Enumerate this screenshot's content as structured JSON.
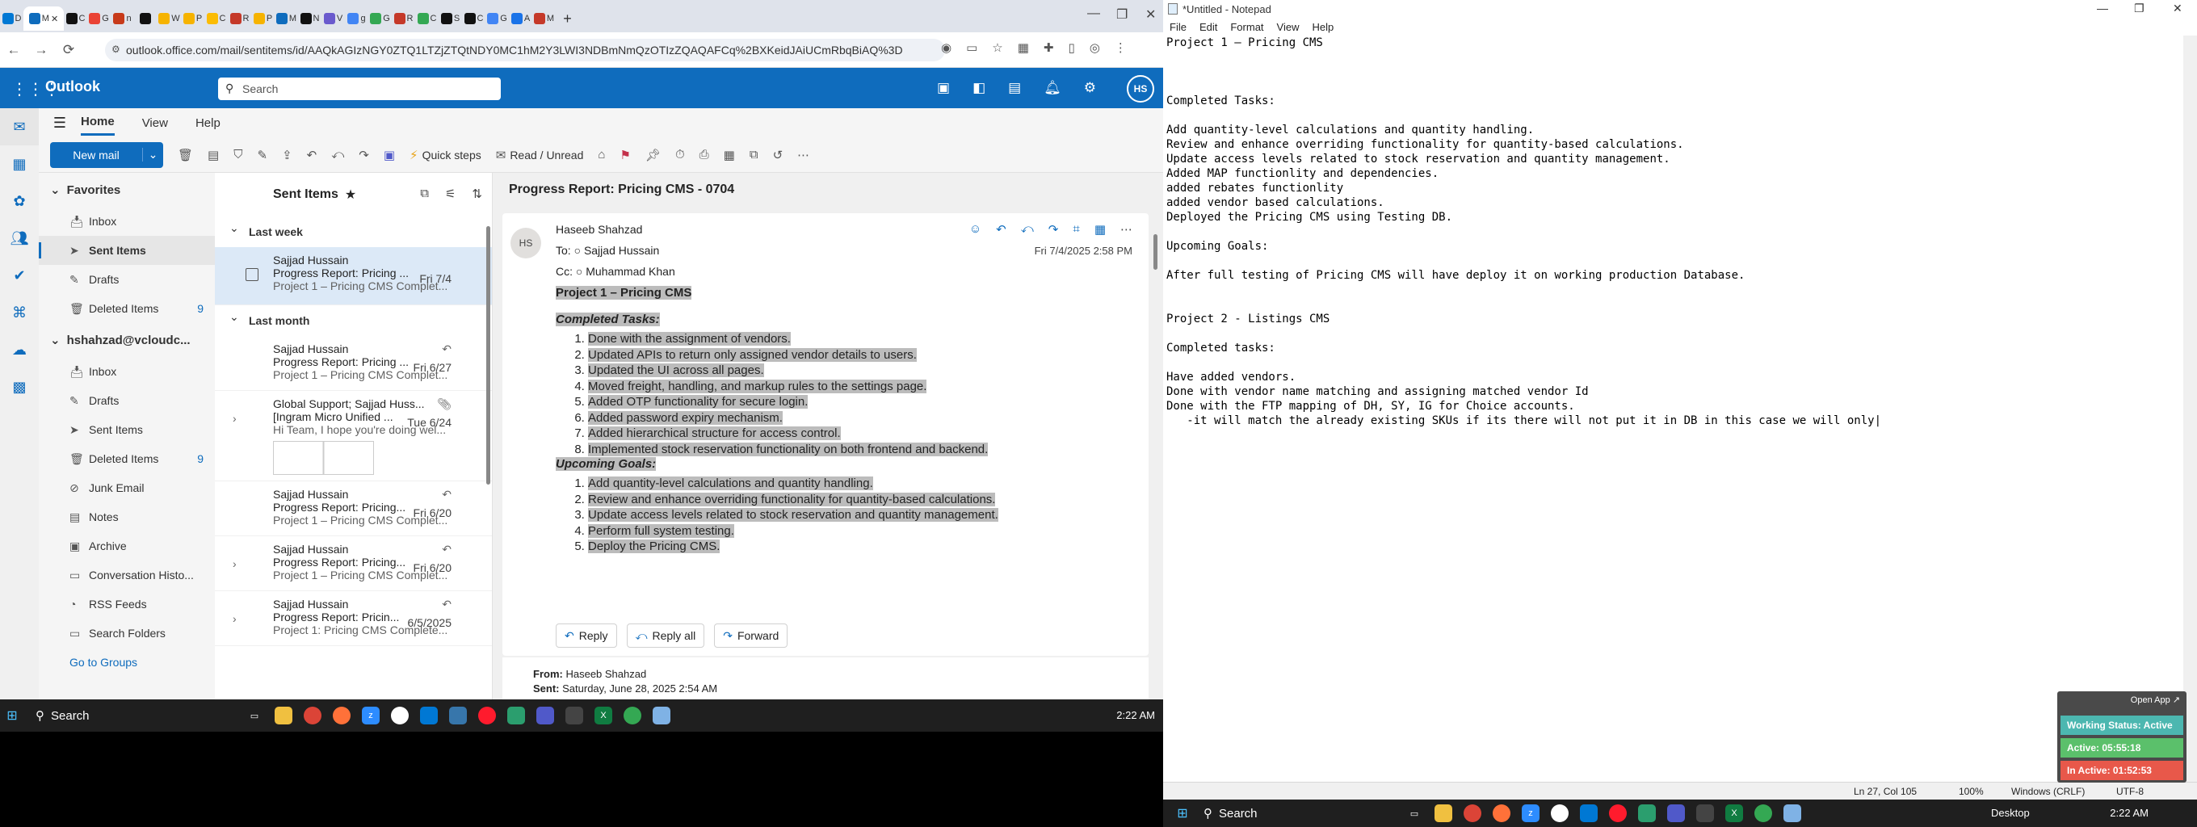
{
  "browser": {
    "tabs": [
      "D",
      "",
      "C",
      "G",
      "n",
      "",
      "W",
      "P",
      "C",
      "R",
      "P",
      "M",
      "N",
      "V",
      "g",
      "G",
      "R",
      "C",
      "S",
      "C",
      "G",
      "A",
      "M"
    ],
    "tab_colors": [
      "#0078d4",
      "#0f6cbd",
      "#111111",
      "#ea4335",
      "#c73a1a",
      "#111111",
      "#f6b300",
      "#f6b300",
      "#fbbc04",
      "#c53929",
      "#f6b300",
      "#0f6cbd",
      "#111111",
      "#6a5acd",
      "#4285f4",
      "#34a853",
      "#c53929",
      "#34a853",
      "#111111",
      "#111111",
      "#4285f4",
      "#1a73e8",
      "#c53929"
    ],
    "active_tab_label": "M",
    "url": "outlook.office.com/mail/sentitems/id/AAQkAGIzNGY0ZTQ1LTZjZTQtNDY0MC1hM2Y3LWI3NDBmNmQzOTIzZQAQAFCq%2BXKeidJAiUCmRbqBiAQ%3D"
  },
  "outlook": {
    "brand": "Outlook",
    "search_placeholder": "Search",
    "user_initials": "HS",
    "ribbon_tabs": [
      "Home",
      "View",
      "Help"
    ],
    "new_mail": "New mail",
    "quick_steps": "Quick steps",
    "read_unread": "Read / Unread"
  },
  "folders": {
    "favorites_header": "Favorites",
    "favorites": [
      {
        "label": "Inbox",
        "count": ""
      },
      {
        "label": "Sent Items",
        "count": ""
      },
      {
        "label": "Drafts",
        "count": ""
      },
      {
        "label": "Deleted Items",
        "count": "9"
      }
    ],
    "account_header": "hshahzad@vcloudc...",
    "account": [
      {
        "label": "Inbox",
        "count": ""
      },
      {
        "label": "Drafts",
        "count": ""
      },
      {
        "label": "Sent Items",
        "count": ""
      },
      {
        "label": "Deleted Items",
        "count": "9"
      },
      {
        "label": "Junk Email",
        "count": ""
      },
      {
        "label": "Notes",
        "count": ""
      },
      {
        "label": "Archive",
        "count": ""
      },
      {
        "label": "Conversation Histo...",
        "count": ""
      },
      {
        "label": "RSS Feeds",
        "count": ""
      },
      {
        "label": "Search Folders",
        "count": ""
      }
    ],
    "go_to_groups": "Go to Groups"
  },
  "message_list": {
    "title": "Sent Items",
    "groups": [
      "Last week",
      "Last month"
    ],
    "messages": [
      {
        "from": "Sajjad Hussain",
        "subject": "Progress Report: Pricing ...",
        "date": "Fri 7/4",
        "preview": "Project 1 – Pricing CMS Complet..."
      },
      {
        "from": "Sajjad Hussain",
        "subject": "Progress Report: Pricing ...",
        "date": "Fri 6/27",
        "preview": "Project 1 – Pricing CMS Complet..."
      },
      {
        "from": "Global Support; Sajjad Huss...",
        "subject": "[Ingram Micro Unified ...",
        "date": "Tue 6/24",
        "preview": "Hi Team, I hope you're doing wel..."
      },
      {
        "from": "Sajjad Hussain",
        "subject": "Progress Report: Pricing...",
        "date": "Fri 6/20",
        "preview": "Project 1 – Pricing CMS Complet..."
      },
      {
        "from": "Sajjad Hussain",
        "subject": "Progress Report: Pricing...",
        "date": "Fri 6/20",
        "preview": "Project 1 – Pricing CMS Complet..."
      },
      {
        "from": "Sajjad Hussain",
        "subject": "Progress Report: Pricin...",
        "date": "6/5/2025",
        "preview": "Project 1: Pricing CMS Complete..."
      }
    ]
  },
  "reading": {
    "subject": "Progress Report: Pricing CMS - 0704",
    "avatar": "HS",
    "sender": "Haseeb Shahzad",
    "to_label": "To:",
    "to": "Sajjad Hussain",
    "cc_label": "Cc:",
    "cc": "Muhammad Khan",
    "date": "Fri 7/4/2025 2:58 PM",
    "heading": "Project 1 – Pricing CMS",
    "completed_heading": "Completed Tasks:",
    "completed": [
      "Done with the assignment of vendors.",
      "Updated APIs to return only assigned vendor details to users.",
      "Updated the UI across all pages.",
      "Moved freight, handling, and markup rules to the settings page.",
      "Added OTP functionality for secure login.",
      "Added password expiry mechanism.",
      "Added hierarchical structure for access control.",
      "Implemented stock reservation functionality on both frontend and backend."
    ],
    "upcoming_heading": "Upcoming Goals:",
    "upcoming": [
      "Add quantity-level calculations and quantity handling.",
      "Review and enhance overriding functionality for quantity-based calculations.",
      "Update access levels related to stock reservation and quantity management.",
      "Perform full system testing.",
      "Deploy the Pricing CMS."
    ],
    "reply": "Reply",
    "reply_all": "Reply all",
    "forward": "Forward",
    "from_label": "From:",
    "from_value": "Haseeb Shahzad",
    "sent_label": "Sent:",
    "sent_value": "Saturday, June 28, 2025 2:54 AM"
  },
  "taskbar_left": {
    "search": "Search",
    "time": "2:22 AM"
  },
  "notepad": {
    "title": "*Untitled - Notepad",
    "menu": [
      "File",
      "Edit",
      "Format",
      "View",
      "Help"
    ],
    "text": "Project 1 – Pricing CMS\n\n\n\nCompleted Tasks:\n\nAdd quantity-level calculations and quantity handling.\nReview and enhance overriding functionality for quantity-based calculations.\nUpdate access levels related to stock reservation and quantity management.\nAdded MAP functionlity and dependencies.\nadded rebates functionlity\nadded vendor based calculations.\nDeployed the Pricing CMS using Testing DB.\n\nUpcoming Goals:\n\nAfter full testing of Pricing CMS will have deploy it on working production Database.\n\n\nProject 2 - Listings CMS\n\nCompleted tasks:\n\nHave added vendors.\nDone with vendor name matching and assigning matched vendor Id\nDone with the FTP mapping of DH, SY, IG for Choice accounts.\n   -it will match the already existing SKUs if its there will not put it in DB in this case we will only|",
    "status_pos": "Ln 27, Col 105",
    "status_zoom": "100%",
    "status_eol": "Windows (CRLF)",
    "status_enc": "UTF-8"
  },
  "widget": {
    "open_app": "Open App ↗",
    "working_status": "Working Status: Active",
    "active": "Active: 05:55:18",
    "inactive": "In Active: 01:52:53"
  },
  "taskbar_right": {
    "search": "Search",
    "desktop": "Desktop",
    "time": "2:22 AM"
  }
}
